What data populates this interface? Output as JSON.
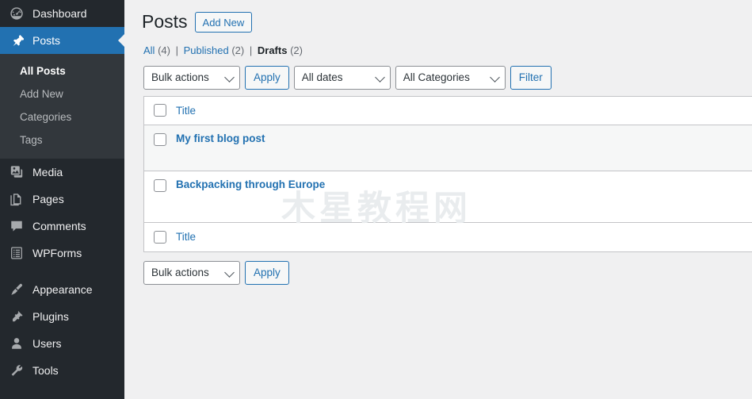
{
  "sidebar": {
    "items": [
      {
        "label": "Dashboard",
        "icon": "dashboard-icon",
        "active": false
      },
      {
        "label": "Posts",
        "icon": "pin-icon",
        "active": true
      },
      {
        "label": "Media",
        "icon": "media-icon",
        "active": false
      },
      {
        "label": "Pages",
        "icon": "pages-icon",
        "active": false
      },
      {
        "label": "Comments",
        "icon": "comment-icon",
        "active": false
      },
      {
        "label": "WPForms",
        "icon": "wpforms-icon",
        "active": false
      },
      {
        "label": "Appearance",
        "icon": "brush-icon",
        "active": false
      },
      {
        "label": "Plugins",
        "icon": "plug-icon",
        "active": false
      },
      {
        "label": "Users",
        "icon": "user-icon",
        "active": false
      },
      {
        "label": "Tools",
        "icon": "wrench-icon",
        "active": false
      }
    ],
    "submenu": [
      {
        "label": "All Posts",
        "current": true
      },
      {
        "label": "Add New",
        "current": false
      },
      {
        "label": "Categories",
        "current": false
      },
      {
        "label": "Tags",
        "current": false
      }
    ]
  },
  "header": {
    "title": "Posts",
    "add_new_label": "Add New"
  },
  "status_links": [
    {
      "label": "All",
      "count": "(4)",
      "current": false
    },
    {
      "label": "Published",
      "count": "(2)",
      "current": false
    },
    {
      "label": "Drafts",
      "count": "(2)",
      "current": true
    }
  ],
  "toolbar_top": {
    "bulk_actions": "Bulk actions",
    "apply_label": "Apply",
    "all_dates": "All dates",
    "all_categories": "All Categories",
    "filter_label": "Filter"
  },
  "toolbar_bottom": {
    "bulk_actions": "Bulk actions",
    "apply_label": "Apply"
  },
  "table": {
    "column_title": "Title",
    "rows": [
      {
        "title": "My first blog post"
      },
      {
        "title": "Backpacking through Europe"
      }
    ]
  },
  "watermark": {
    "text": "木星教程网"
  },
  "colors": {
    "sidebar_bg": "#23282d",
    "submenu_bg": "#32373c",
    "accent": "#2271b1",
    "page_bg": "#f0f0f1",
    "row_alt": "#f6f7f7",
    "border": "#c3c4c7",
    "link": "#2271b1"
  }
}
